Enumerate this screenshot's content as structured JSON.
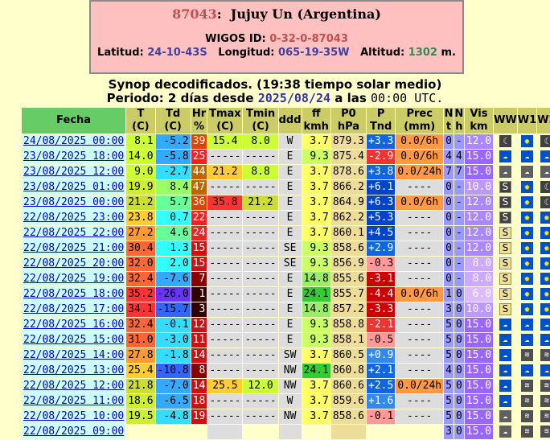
{
  "header": {
    "station_id": "87043",
    "station_name": "Jujuy Un (Argentina)",
    "wigos_label": "WIGOS ID:",
    "wigos_value": "0-32-0-87043",
    "lat_label": "Latitud:",
    "lat_value": "24-10-43S",
    "lon_label": "Longitud:",
    "lon_value": "065-19-35W",
    "alt_label": "Altitud:",
    "alt_value": "1302",
    "alt_unit": "m."
  },
  "subtitle": {
    "line1": "Synop decodificados. (19:38 tiempo solar medio)",
    "line2_prefix": "Periodo: 2 días desde ",
    "line2_date": "2025/08/24",
    "line2_mid": " a las ",
    "line2_time": "00:00 UTC."
  },
  "columns": [
    "Fecha",
    "T\n(C)",
    "Td\n(C)",
    "Hr\n%",
    "Tmax\n(C)",
    "Tmin\n(C)",
    "ddd",
    "ff\nkmh",
    "P0\nhPa",
    "P\nTnd",
    "Prec\n(mm)",
    "N\nt",
    "N\nh",
    "Vis\nkm",
    "WW",
    "W1",
    "W2"
  ],
  "colors": {
    "background": "#FFFFCC",
    "header_box": "#FFC0C0",
    "col_header": "#CCCC66",
    "date_header": "#66CC66",
    "date_cell": "#CCFFFF"
  },
  "rows": [
    {
      "fecha": "24/08/2025 00:00",
      "t": "8.1",
      "td": "-5.2",
      "hr": "39",
      "tmax": "15.4",
      "tmin": "8.0",
      "ddd": "W",
      "ff": "3.7",
      "p0": "879.3",
      "ptnd": "+3.3",
      "prec": "0.0/6h",
      "nt": "0",
      "nh": "-",
      "vis": "12.0",
      "ww": "moon",
      "w1": "sun",
      "w2": "moon"
    },
    {
      "fecha": "23/08/2025 18:00",
      "t": "14.0",
      "td": "-5.8",
      "hr": "25",
      "tmax": "-----",
      "tmin": "-----",
      "ddd": "E",
      "ff": "9.3",
      "p0": "875.4",
      "ptnd": "-2.9",
      "prec": "0.0/6h",
      "nt": "4",
      "nh": "4",
      "vis": "15.0",
      "ww": "cloudsun",
      "w1": "cloudsun",
      "w2": "cloudsun"
    },
    {
      "fecha": "23/08/2025 12:00",
      "t": "9.0",
      "td": "-2.7",
      "hr": "44",
      "tmax": "21.2",
      "tmin": "8.8",
      "ddd": "E",
      "ff": "3.7",
      "p0": "878.6",
      "ptnd": "+3.8",
      "prec": "0.0/24h",
      "nt": "7",
      "nh": "7",
      "vis": "15.0",
      "ww": "cloud",
      "w1": "cloud",
      "w2": "cloud"
    },
    {
      "fecha": "23/08/2025 01:00",
      "t": "19.9",
      "td": "8.4",
      "hr": "47",
      "tmax": "-----",
      "tmin": "-----",
      "ddd": "E",
      "ff": "3.7",
      "p0": "866.2",
      "ptnd": "+6.1",
      "prec": "----",
      "nt": "0",
      "nh": "-",
      "vis": "10.0",
      "ww": "sdark",
      "w1": "sun",
      "w2": "moon"
    },
    {
      "fecha": "23/08/2025 00:00",
      "t": "21.2",
      "td": "5.7",
      "hr": "36",
      "tmax": "35.8",
      "tmin": "21.2",
      "ddd": "E",
      "ff": "3.7",
      "p0": "864.9",
      "ptnd": "+6.3",
      "prec": "0.0/6h",
      "nt": "0",
      "nh": "-",
      "vis": "12.0",
      "ww": "sdark",
      "w1": "sun",
      "w2": "moon"
    },
    {
      "fecha": "22/08/2025 23:00",
      "t": "23.8",
      "td": "0.7",
      "hr": "22",
      "tmax": "-----",
      "tmin": "-----",
      "ddd": "E",
      "ff": "3.7",
      "p0": "862.2",
      "ptnd": "+5.3",
      "prec": "----",
      "nt": "0",
      "nh": "-",
      "vis": "12.0",
      "ww": "sdark",
      "w1": "sun",
      "w2": "sun"
    },
    {
      "fecha": "22/08/2025 22:00",
      "t": "27.2",
      "td": "4.6",
      "hr": "24",
      "tmax": "-----",
      "tmin": "-----",
      "ddd": "E",
      "ff": "3.7",
      "p0": "860.1",
      "ptnd": "+4.5",
      "prec": "----",
      "nt": "0",
      "nh": "-",
      "vis": "12.0",
      "ww": "sletter",
      "w1": "sun",
      "w2": "sun"
    },
    {
      "fecha": "22/08/2025 21:00",
      "t": "30.4",
      "td": "1.3",
      "hr": "15",
      "tmax": "-----",
      "tmin": "-----",
      "ddd": "SE",
      "ff": "9.3",
      "p0": "858.6",
      "ptnd": "+2.9",
      "prec": "----",
      "nt": "0",
      "nh": "-",
      "vis": "12.0",
      "ww": "sletter",
      "w1": "sun",
      "w2": "sun"
    },
    {
      "fecha": "22/08/2025 20:00",
      "t": "32.0",
      "td": "2.0",
      "hr": "15",
      "tmax": "-----",
      "tmin": "-----",
      "ddd": "SE",
      "ff": "9.3",
      "p0": "856.9",
      "ptnd": "-0.3",
      "prec": "----",
      "nt": "0",
      "nh": "-",
      "vis": "8.0",
      "ww": "sletter",
      "w1": "sun",
      "w2": "sun"
    },
    {
      "fecha": "22/08/2025 19:00",
      "t": "32.4",
      "td": "-7.6",
      "hr": "7",
      "tmax": "-----",
      "tmin": "-----",
      "ddd": "E",
      "ff": "14.8",
      "p0": "855.6",
      "ptnd": "-3.1",
      "prec": "----",
      "nt": "0",
      "nh": "-",
      "vis": "8.0",
      "ww": "sletter",
      "w1": "sun",
      "w2": "sun"
    },
    {
      "fecha": "22/08/2025 18:00",
      "t": "35.2",
      "td": "-26.0",
      "hr": "1",
      "tmax": "-----",
      "tmin": "-----",
      "ddd": "E",
      "ff": "24.1",
      "p0": "855.7",
      "ptnd": "-4.4",
      "prec": "0.0/6h",
      "nt": "1",
      "nh": "0",
      "vis": "6.0",
      "ww": "sletter",
      "w1": "sun",
      "w2": "sun"
    },
    {
      "fecha": "22/08/2025 17:00",
      "t": "34.1",
      "td": "-15.7",
      "hr": "3",
      "tmax": "-----",
      "tmin": "-----",
      "ddd": "E",
      "ff": "14.8",
      "p0": "857.2",
      "ptnd": "-3.3",
      "prec": "----",
      "nt": "3",
      "nh": "0",
      "vis": "10.0",
      "ww": "sletter",
      "w1": "sun",
      "w2": "sun"
    },
    {
      "fecha": "22/08/2025 16:00",
      "t": "32.4",
      "td": "-0.1",
      "hr": "12",
      "tmax": "-----",
      "tmin": "-----",
      "ddd": "E",
      "ff": "9.3",
      "p0": "858.8",
      "ptnd": "-2.1",
      "prec": "----",
      "nt": "5",
      "nh": "0",
      "vis": "15.0",
      "ww": "cloudsun",
      "w1": "cloudsun",
      "w2": "cloudsun"
    },
    {
      "fecha": "22/08/2025 15:00",
      "t": "31.0",
      "td": "-3.0",
      "hr": "11",
      "tmax": "-----",
      "tmin": "-----",
      "ddd": "E",
      "ff": "9.3",
      "p0": "858.1",
      "ptnd": "-0.5",
      "prec": "----",
      "nt": "5",
      "nh": "0",
      "vis": "15.0",
      "ww": "cloudsun",
      "w1": "cloudsun",
      "w2": "cloudsun"
    },
    {
      "fecha": "22/08/2025 14:00",
      "t": "27.8",
      "td": "-1.8",
      "hr": "14",
      "tmax": "-----",
      "tmin": "-----",
      "ddd": "SW",
      "ff": "3.7",
      "p0": "860.5",
      "ptnd": "+0.9",
      "prec": "----",
      "nt": "5",
      "nh": "0",
      "vis": "15.0",
      "ww": "cloudsun",
      "w1": "wind",
      "w2": "wind"
    },
    {
      "fecha": "22/08/2025 13:00",
      "t": "25.4",
      "td": "-10.8",
      "hr": "8",
      "tmax": "-----",
      "tmin": "-----",
      "ddd": "NW",
      "ff": "24.1",
      "p0": "860.8",
      "ptnd": "+2.1",
      "prec": "----",
      "nt": "4",
      "nh": "0",
      "vis": "15.0",
      "ww": "cloudsun",
      "w1": "cloudsun",
      "w2": "cloudsun"
    },
    {
      "fecha": "22/08/2025 12:00",
      "t": "21.8",
      "td": "-7.0",
      "hr": "14",
      "tmax": "25.5",
      "tmin": "12.0",
      "ddd": "NW",
      "ff": "3.7",
      "p0": "860.6",
      "ptnd": "+2.5",
      "prec": "0.0/24h",
      "nt": "5",
      "nh": "0",
      "vis": "15.0",
      "ww": "cloudsun",
      "w1": "wind",
      "w2": "wind"
    },
    {
      "fecha": "22/08/2025 11:00",
      "t": "18.6",
      "td": "-6.5",
      "hr": "18",
      "tmax": "-----",
      "tmin": "-----",
      "ddd": "W",
      "ff": "3.7",
      "p0": "859.6",
      "ptnd": "+1.6",
      "prec": "----",
      "nt": "5",
      "nh": "0",
      "vis": "15.0",
      "ww": "cloudsun",
      "w1": "wind",
      "w2": "wind"
    },
    {
      "fecha": "22/08/2025 10:00",
      "t": "19.5",
      "td": "-4.8",
      "hr": "19",
      "tmax": "-----",
      "tmin": "-----",
      "ddd": "NW",
      "ff": "3.7",
      "p0": "858.6",
      "ptnd": "-0.1",
      "prec": "----",
      "nt": "5",
      "nh": "0",
      "vis": "15.0",
      "ww": "cloud",
      "w1": "wind",
      "w2": "wind"
    },
    {
      "fecha": "22/08/2025 09:00",
      "t": "",
      "td": "",
      "hr": "",
      "tmax": "",
      "tmin": "",
      "ddd": "",
      "ff": "",
      "p0": "",
      "ptnd": "",
      "prec": "",
      "nt": "3",
      "nh": "0",
      "vis": "15.0",
      "ww": "cloud",
      "w1": "wind",
      "w2": "wind"
    }
  ]
}
